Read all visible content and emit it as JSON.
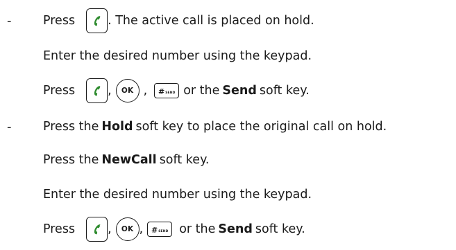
{
  "icons": {
    "call_key": "green-handset-icon",
    "ok_key_label": "OK",
    "hash_key_symbol": "#",
    "hash_key_sublabel": "SEND",
    "handset_color": "#2e8b2e"
  },
  "items": [
    {
      "bullet": "-",
      "lines": {
        "l1_word": "Press",
        "l1_after": ". The active call is placed on hold.",
        "l2": "Enter the desired number using the keypad.",
        "l3_word": "Press",
        "sep1": ",",
        "sep2": ",",
        "l3_or": "or the",
        "l3_bold": "Send",
        "l3_end": "soft key."
      }
    },
    {
      "bullet": "-",
      "lines": {
        "l1_pre": "Press the",
        "l1_bold": "Hold",
        "l1_post": "soft key to place the original call on hold.",
        "l2_pre": "Press the",
        "l2_bold": "NewCall",
        "l2_post": "soft key.",
        "l3": "Enter the desired number using the keypad.",
        "l4_word": "Press",
        "sep1": ",",
        "sep2": ",",
        "l4_or": "or the",
        "l4_bold": "Send",
        "l4_end": "soft key."
      }
    }
  ]
}
